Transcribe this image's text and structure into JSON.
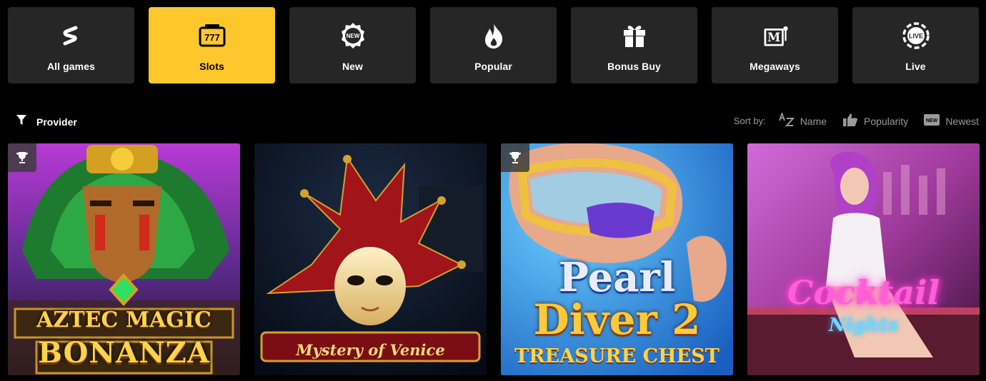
{
  "tabs": [
    {
      "label": "All games",
      "icon": "all-games-icon",
      "active": false
    },
    {
      "label": "Slots",
      "icon": "slot-777-icon",
      "active": true
    },
    {
      "label": "New",
      "icon": "new-badge-icon",
      "active": false
    },
    {
      "label": "Popular",
      "icon": "fire-icon",
      "active": false
    },
    {
      "label": "Bonus Buy",
      "icon": "gift-icon",
      "active": false
    },
    {
      "label": "Megaways",
      "icon": "megaways-icon",
      "active": false
    },
    {
      "label": "Live",
      "icon": "live-chip-icon",
      "active": false
    }
  ],
  "icon_text": {
    "new": "NEW",
    "megaways": "M",
    "live": "LIVE",
    "slots": "777"
  },
  "filter": {
    "label": "Provider"
  },
  "sort": {
    "label": "Sort by:",
    "options": [
      {
        "label": "Name",
        "icon": "az-icon"
      },
      {
        "label": "Popularity",
        "icon": "thumbs-up-icon"
      },
      {
        "label": "Newest",
        "icon": "new-badge-icon",
        "badge": "NEW"
      }
    ]
  },
  "games": [
    {
      "line1": "AZTEC MAGIC",
      "line2": "BONANZA",
      "trophy": true
    },
    {
      "line1": "Mystery of Venice",
      "trophy": false
    },
    {
      "line1": "Pearl",
      "line2": "Diver 2",
      "line3": "TREASURE CHEST",
      "trophy": true
    },
    {
      "line1": "Cocktail",
      "line2": "Nights",
      "trophy": false
    }
  ],
  "colors": {
    "accent": "#fec72c",
    "tab_bg": "#262626",
    "background": "#000000"
  }
}
